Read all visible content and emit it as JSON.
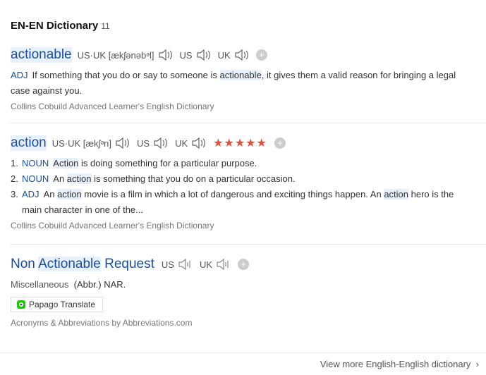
{
  "section": {
    "title": "EN-EN Dictionary",
    "count": "11"
  },
  "entries": [
    {
      "word": "actionable",
      "pron_us_uk_label": "US·UK",
      "ipa": "[ækʃənəbᵊl]",
      "us_label": "US",
      "uk_label": "UK",
      "pos": "ADJ",
      "def_before": "If something that you do or say to someone is ",
      "def_hl": "actionable",
      "def_after": ", it gives them a valid reason for bringing a legal case against you.",
      "source": "Collins Cobuild Advanced Learner's English Dictionary"
    },
    {
      "word": "action",
      "pron_us_uk_label": "US·UK",
      "ipa": "[ækʃᵊn]",
      "us_label": "US",
      "uk_label": "UK",
      "stars": "★★★★★",
      "defs": [
        {
          "num": "1.",
          "pos": "NOUN",
          "hl": "Action",
          "rest": " is doing something for a particular purpose."
        },
        {
          "num": "2.",
          "pos": "NOUN",
          "pre": "An ",
          "hl": "action",
          "rest": " is something that you do on a particular occasion."
        },
        {
          "num": "3.",
          "pos": "ADJ",
          "pre": "An ",
          "hl": "action",
          "mid": " movie is a film in which a lot of dangerous and exciting things happen. An ",
          "hl2": "action",
          "rest": " hero is the main character in one of the..."
        }
      ],
      "source": "Collins Cobuild Advanced Learner's English Dictionary"
    },
    {
      "word_pre": "Non ",
      "word_hl": "Actionable",
      "word_post": " Request",
      "us_label": "US",
      "uk_label": "UK",
      "category": "Miscellaneous",
      "def": "(Abbr.) NAR.",
      "papago": "Papago Translate",
      "source": "Acronyms & Abbreviations by Abbreviations.com"
    }
  ],
  "footer": {
    "view_more": "View more English-English dictionary",
    "chevron": "›"
  }
}
